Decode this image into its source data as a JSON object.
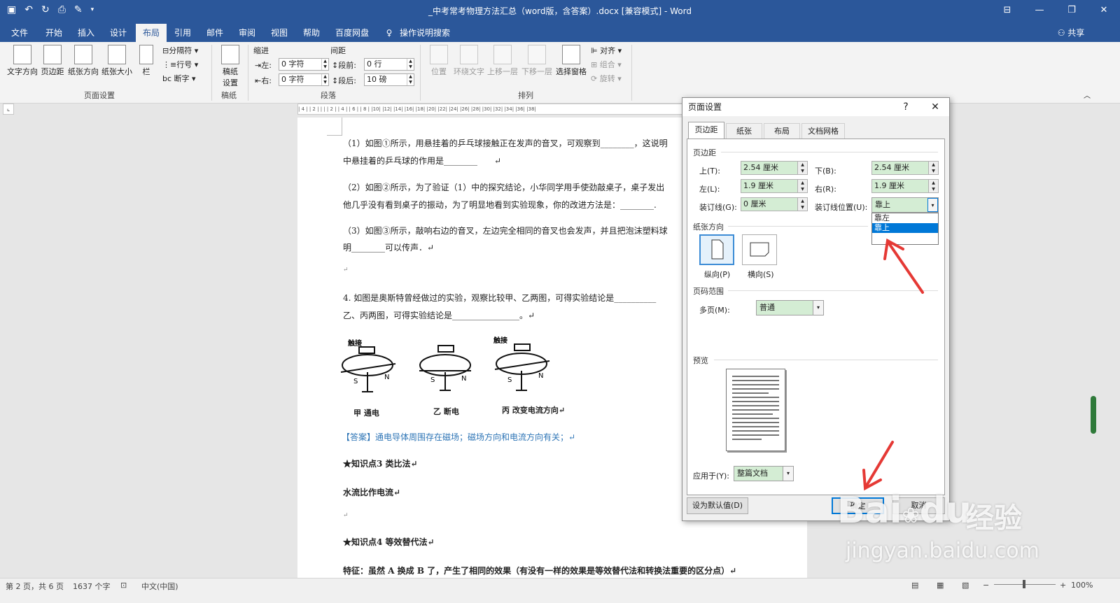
{
  "title": {
    "text": "_中考常考物理方法汇总（word版，含答案）.docx [兼容模式] - Word"
  },
  "ribbon": {
    "tabs": [
      "文件",
      "开始",
      "插入",
      "设计",
      "布局",
      "引用",
      "邮件",
      "审阅",
      "视图",
      "帮助",
      "百度网盘",
      "操作说明搜索"
    ],
    "share": "共享",
    "page_setup": {
      "text_dir": "文字方向",
      "margins": "页边距",
      "orientation": "纸张方向",
      "size": "纸张大小",
      "columns": "栏",
      "breaks": "分隔符",
      "line_numbers": "行号",
      "hyphenation": "断字",
      "label": "页面设置"
    },
    "manuscript": {
      "btn": "稿纸\n设置",
      "label": "稿纸"
    },
    "paragraph": {
      "indent": "缩进",
      "spacing": "间距",
      "left_lbl": "左:",
      "right_lbl": "右:",
      "before_lbl": "段前:",
      "after_lbl": "段后:",
      "left_val": "0 字符",
      "right_val": "0 字符",
      "before_val": "0 行",
      "after_val": "10 磅",
      "label": "段落"
    },
    "arrange": {
      "position": "位置",
      "wrap": "环绕文字",
      "forward": "上移一层",
      "backward": "下移一层",
      "pane": "选择窗格",
      "align": "对齐",
      "group": "组合",
      "rotate": "旋转",
      "label": "排列"
    }
  },
  "ruler": {
    "text": "| 4 | | 2 | | | | 2 | | 4 | | 6 | | 8 | |10| |12| |14| |16| |18| |20| |22| |24| |26| |28| |30| |32| |34| |36| |38|"
  },
  "doc": {
    "p1a": "（1）如图①所示，用悬挂着的乒乓球接触正在发声的音叉，可观察到________，这说明",
    "p1b": "中悬挂着的乒乓球的作用是________　　↵",
    "p2a": "（2）如图②所示，为了验证（1）中的探究结论，小华同学用手使劲敲桌子，桌子发出",
    "p2b": "他几乎没有看到桌子的振动，为了明显地看到实验现象，你的改进方法是：________.",
    "p3a": "（3）如图③所示，敲响右边的音叉，左边完全相同的音叉也会发声，并且把泡沫塑料球",
    "p3b": "明________可以传声．↵",
    "e1": "↵",
    "q4a": "4. 如图是奥斯特曾经做过的实验，观察比较甲、乙两图，可得实验结论是__________",
    "q4b": "乙、丙两图，可得实验结论是________________。↵",
    "fig_touch1": "触接",
    "fig_touch3": "触接",
    "fig_s": "S",
    "fig_n": "N",
    "cap1": "甲  通电",
    "cap2": "乙  断电",
    "cap3": "丙  改变电流方向↵",
    "answer": "【答案】通电导体周围存在磁场；磁场方向和电流方向有关；↵",
    "k3": "★知识点3 类比法↵",
    "water": "水流比作电流↵",
    "e2": "↵",
    "k4": "★知识点4 等效替代法↵",
    "feat": "特征：虽然 A 换成 B 了，产生了相同的效果（有没有一样的效果是等效替代法和转换法重要的区分点）↵"
  },
  "status": {
    "page": "第 2 页，共 6 页",
    "words": "1637 个字",
    "lang": "中文(中国)",
    "zoom": "100%"
  },
  "dialog": {
    "title": "页面设置",
    "help": "?",
    "close": "✕",
    "tabs": [
      "页边距",
      "纸张",
      "布局",
      "文档网格"
    ],
    "margins_label": "页边距",
    "top_lbl": "上(T):",
    "top_val": "2.54 厘米",
    "bottom_lbl": "下(B):",
    "bottom_val": "2.54 厘米",
    "left_lbl": "左(L):",
    "left_val": "1.9 厘米",
    "right_lbl": "右(R):",
    "right_val": "1.9 厘米",
    "gutter_lbl": "装订线(G):",
    "gutter_val": "0 厘米",
    "gutter_pos_lbl": "装订线位置(U):",
    "gutter_pos_val": "靠上",
    "gutter_options": [
      "靠左",
      "靠上"
    ],
    "orient_label": "纸张方向",
    "portrait": "纵向(P)",
    "landscape": "横向(S)",
    "pages_label": "页码范围",
    "multi_lbl": "多页(M):",
    "multi_val": "普通",
    "preview_label": "预览",
    "apply_lbl": "应用于(Y):",
    "apply_val": "整篇文档",
    "set_default": "设为默认值(D)",
    "ok": "确定",
    "cancel": "取消"
  },
  "watermark": {
    "brand": "Bai",
    "brand2": "du",
    "jy": "经验",
    "url": "jingyan.baidu.com"
  },
  "colors": {
    "accent": "#2b579a",
    "arrow": "#e53935",
    "highlight": "#0078d7",
    "answer": "#2e75b6"
  }
}
